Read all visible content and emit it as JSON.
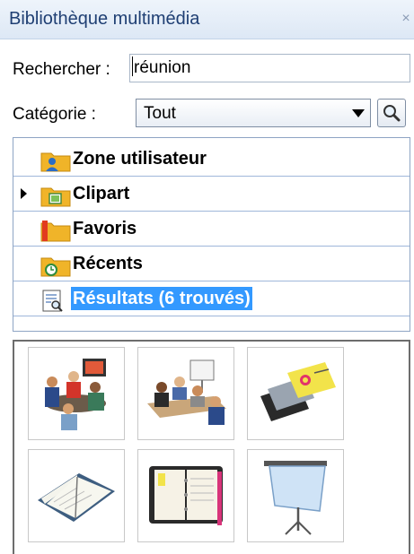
{
  "panel": {
    "title": "Bibliothèque multimédia",
    "close_glyph": "×"
  },
  "search": {
    "label": "Rechercher :",
    "value": "réunion"
  },
  "category": {
    "label": "Catégorie :",
    "selected": "Tout",
    "button_icon": "magnifier-icon"
  },
  "tree": {
    "items": [
      {
        "label": "Zone utilisateur",
        "icon": "user-folder-icon",
        "expandable": false,
        "selected": false
      },
      {
        "label": "Clipart",
        "icon": "clipart-folder-icon",
        "expandable": true,
        "selected": false
      },
      {
        "label": "Favoris",
        "icon": "favorites-folder-icon",
        "expandable": false,
        "selected": false
      },
      {
        "label": "Récents",
        "icon": "recent-folder-icon",
        "expandable": false,
        "selected": false
      },
      {
        "label": "Résultats (6 trouvés)",
        "icon": "search-results-icon",
        "expandable": false,
        "selected": true
      }
    ]
  },
  "results": {
    "thumbnails": [
      {
        "name": "meeting-videoconference-clipart"
      },
      {
        "name": "meeting-presentation-clipart"
      },
      {
        "name": "business-cards-clipart"
      },
      {
        "name": "open-agenda-clipart"
      },
      {
        "name": "organizer-binder-clipart"
      },
      {
        "name": "projection-screen-clipart"
      }
    ]
  },
  "colors": {
    "title_text": "#1f3f73",
    "selection": "#3399ff",
    "folder_yellow": "#f0b429",
    "row_divider": "#9fb7da"
  }
}
